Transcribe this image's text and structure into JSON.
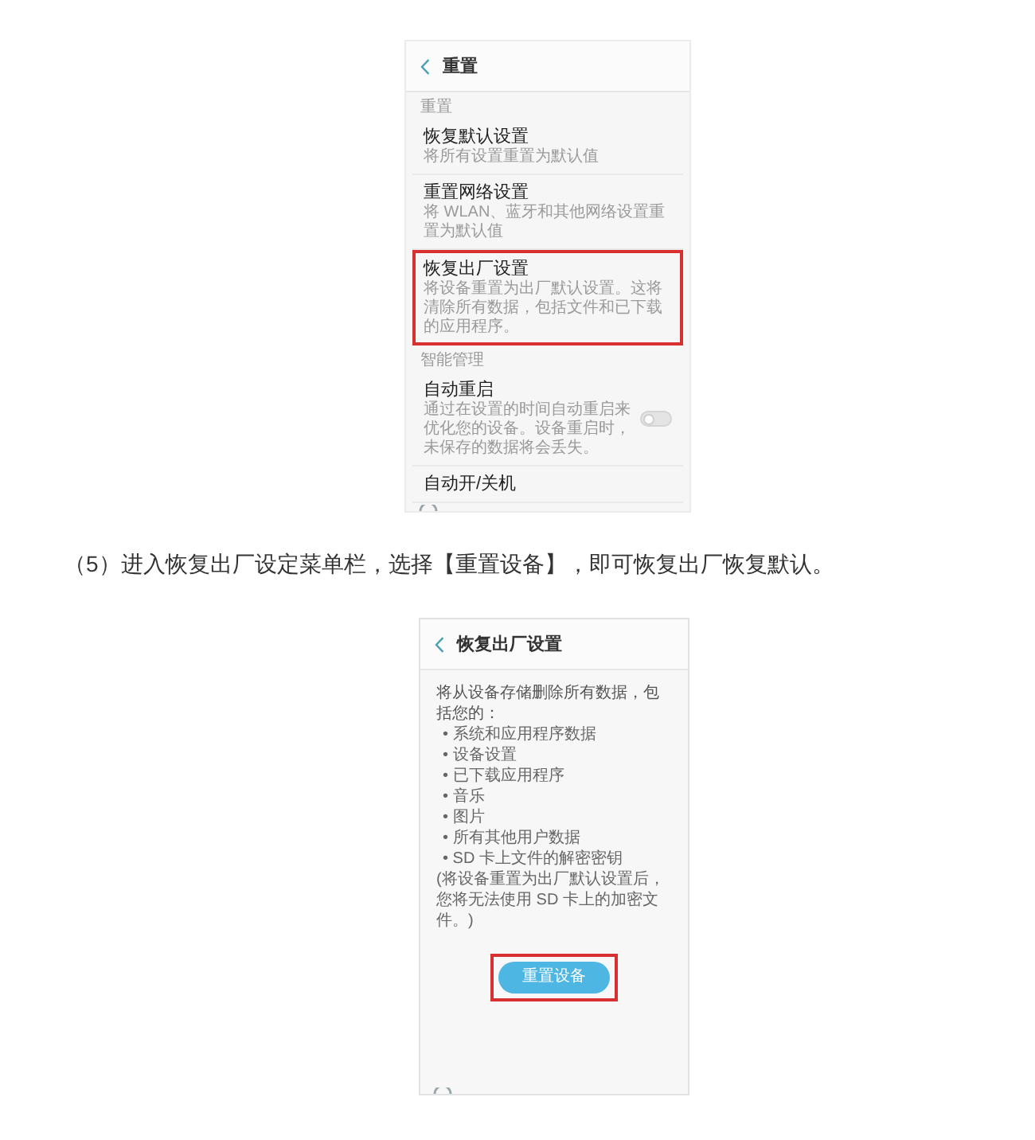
{
  "reset_screenshot": {
    "title": "重置",
    "sections": [
      {
        "label": "重置",
        "items": [
          {
            "title": "恢复默认设置",
            "subtitle": "将所有设置重置为默认值",
            "highlighted": false
          },
          {
            "title": "重置网络设置",
            "subtitle": "将 WLAN、蓝牙和其他网络设置重置为默认值",
            "highlighted": false
          },
          {
            "title": "恢复出厂设置",
            "subtitle": "将设备重置为出厂默认设置。这将清除所有数据，包括文件和已下载的应用程序。",
            "highlighted": true
          }
        ]
      },
      {
        "label": "智能管理",
        "items": [
          {
            "title": "自动重启",
            "subtitle": "通过在设置的时间自动重启来优化您的设备。设备重启时，未保存的数据将会丢失。",
            "highlighted": false,
            "toggle": {
              "on": false
            }
          },
          {
            "title": "自动开/关机",
            "highlighted": false
          }
        ]
      }
    ]
  },
  "step_caption": "（5）进入恢复出厂设定菜单栏，选择【重置设备】，即可恢复出厂恢复默认。",
  "factory_reset_screenshot": {
    "title": "恢复出厂设置",
    "intro": "将从设备存储删除所有数据，包括您的：",
    "bullets": [
      "• 系统和应用程序数据",
      "• 设备设置",
      "• 已下载应用程序",
      "• 音乐",
      "• 图片",
      "• 所有其他用户数据",
      "• SD 卡上文件的解密密钥"
    ],
    "note": "(将设备重置为出厂默认设置后，您将无法使用 SD 卡上的加密文件。)",
    "button": {
      "label": "重置设备",
      "highlighted": true
    }
  }
}
